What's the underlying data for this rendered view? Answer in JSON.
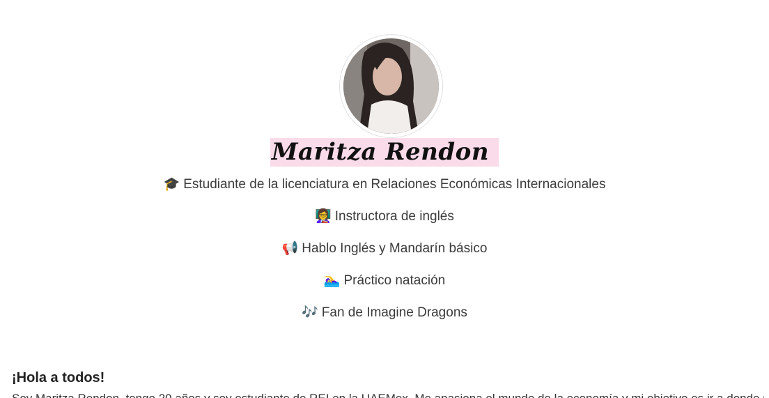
{
  "profile": {
    "name": "Maritza Rendon",
    "avatar_alt": "profile photo"
  },
  "facts": [
    {
      "emoji": "🎓",
      "text": "Estudiante de la licenciatura en Relaciones Económicas Internacionales"
    },
    {
      "emoji": "👩‍🏫",
      "text": "Instructora de inglés"
    },
    {
      "emoji": "📢",
      "text": "Hablo Inglés y Mandarín básico"
    },
    {
      "emoji": "🏊‍♀️",
      "text": "Práctico natación"
    },
    {
      "emoji": "🎶",
      "text": "Fan de Imagine Dragons"
    }
  ],
  "intro": {
    "heading": "¡Hola a todos!",
    "text": "Soy Maritza Rendon, tengo 20 años y soy estudiante de REI en la UAEMex. Me apasiona el mundo de la economía y mi objetivo es ir a donde más influya"
  },
  "colors": {
    "name_highlight": "#fadbe9",
    "text": "#3b3b3b"
  }
}
